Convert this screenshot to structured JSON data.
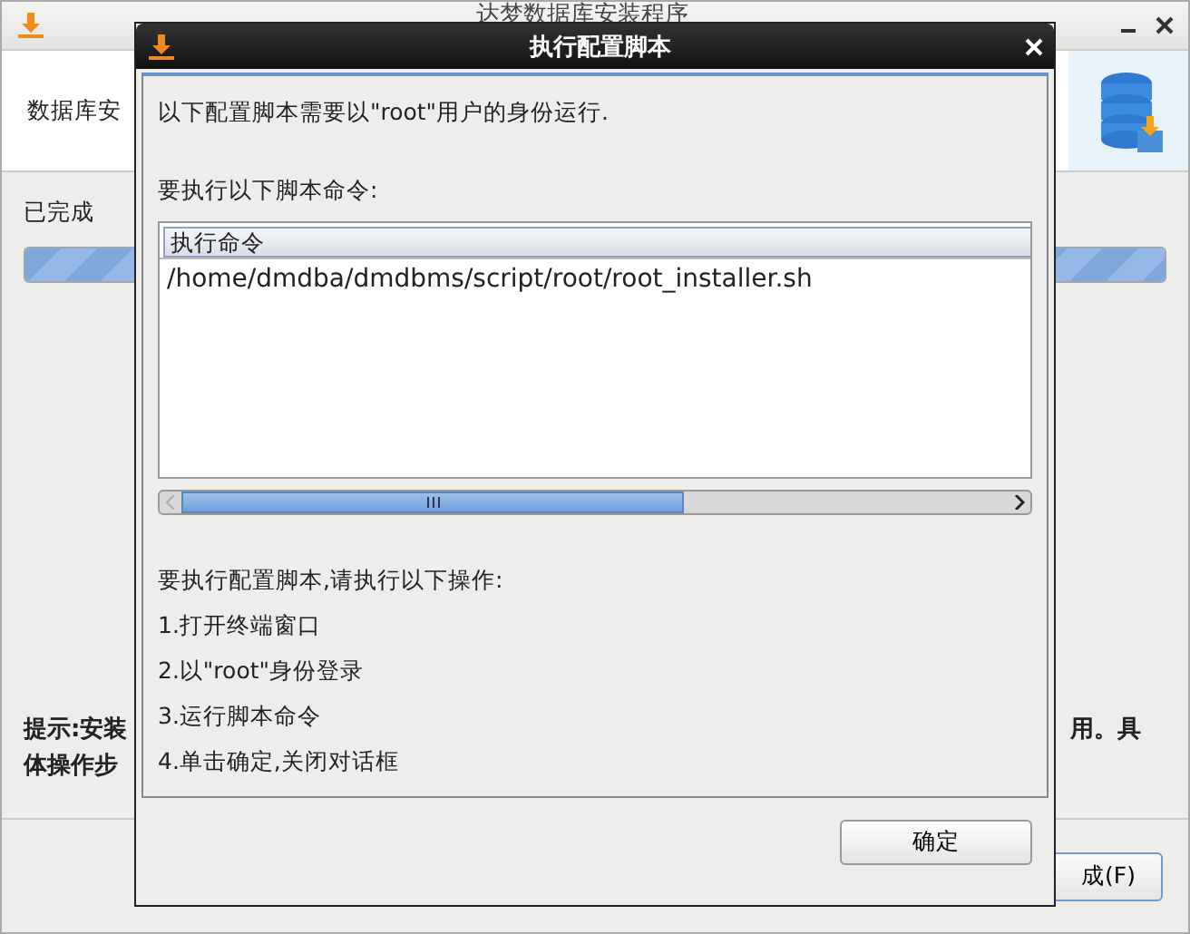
{
  "main_window": {
    "title": "达梦数据库安装程序",
    "header_text": "数据库安",
    "status_label": "已完成",
    "progress": {
      "level": 1
    },
    "hint_left": "提示:安装",
    "hint_right": "用。具",
    "hint_line2": "体操作步",
    "finish_button": "成(F)"
  },
  "dialog": {
    "title": "执行配置脚本",
    "message": "以下配置脚本需要以\"root\"用户的身份运行.",
    "list_label": "要执行以下脚本命令:",
    "table": {
      "columns": [
        "执行命令"
      ],
      "rows": [
        "/home/dmdba/dmdbms/script/root/root_installer.sh"
      ]
    },
    "instructions_title": "要执行配置脚本,请执行以下操作:",
    "steps": [
      "1.打开终端窗口",
      "2.以\"root\"身份登录",
      "3.运行脚本命令",
      "4.单击确定,关闭对话框"
    ],
    "ok_button": "确定"
  }
}
